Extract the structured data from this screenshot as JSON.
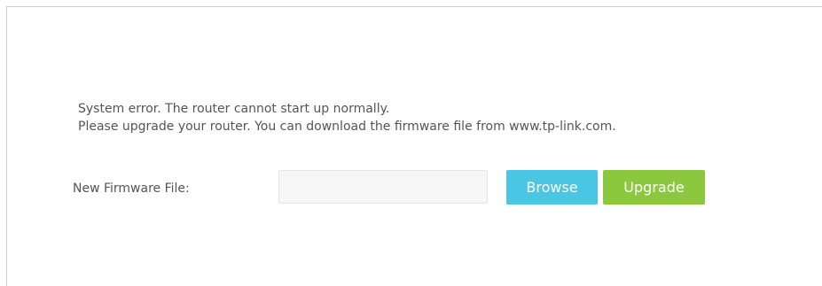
{
  "error": {
    "line1": "System error. The router cannot start up normally.",
    "line2": "Please upgrade your router. You can download the firmware file from www.tp-link.com."
  },
  "firmware": {
    "label": "New Firmware File:",
    "file_value": "",
    "browse_label": "Browse",
    "upgrade_label": "Upgrade"
  },
  "colors": {
    "browse_button": "#4ac5e4",
    "upgrade_button": "#8cc83d",
    "text": "#555555"
  }
}
